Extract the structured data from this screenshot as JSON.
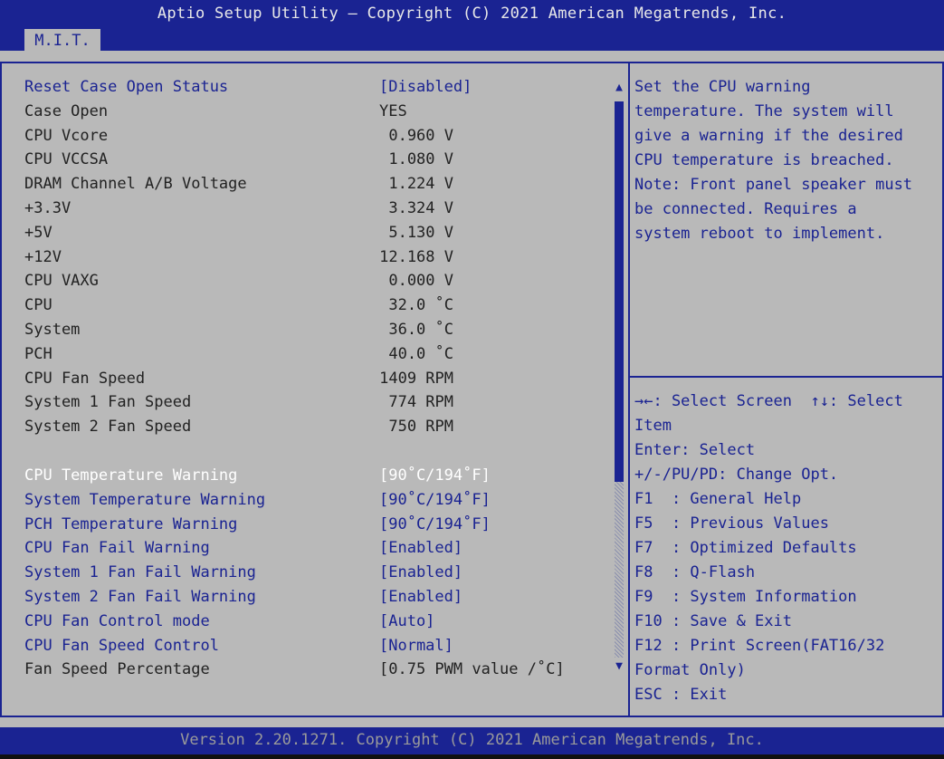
{
  "header": {
    "title": "Aptio Setup Utility – Copyright (C) 2021 American Megatrends, Inc.",
    "tab": "M.I.T."
  },
  "settings": [
    {
      "label": "Reset Case Open Status",
      "value": "[Disabled]",
      "style": "blue",
      "editable": true
    },
    {
      "label": "Case Open",
      "value": "YES",
      "style": "dark",
      "editable": false
    },
    {
      "label": "CPU Vcore",
      "value": "0.960 V",
      "style": "dark",
      "editable": false
    },
    {
      "label": "CPU VCCSA",
      "value": "1.080 V",
      "style": "dark",
      "editable": false
    },
    {
      "label": "DRAM Channel A/B Voltage",
      "value": "1.224 V",
      "style": "dark",
      "editable": false
    },
    {
      "label": "+3.3V",
      "value": "3.324 V",
      "style": "dark",
      "editable": false
    },
    {
      "label": "+5V",
      "value": "5.130 V",
      "style": "dark",
      "editable": false
    },
    {
      "label": "+12V",
      "value": "12.168 V",
      "style": "dark",
      "editable": false
    },
    {
      "label": "CPU VAXG",
      "value": "0.000 V",
      "style": "dark",
      "editable": false
    },
    {
      "label": "CPU",
      "value": "32.0 ˚C",
      "style": "dark",
      "editable": false
    },
    {
      "label": "System",
      "value": "36.0 ˚C",
      "style": "dark",
      "editable": false
    },
    {
      "label": "PCH",
      "value": "40.0 ˚C",
      "style": "dark",
      "editable": false
    },
    {
      "label": "CPU Fan Speed",
      "value": "1409 RPM",
      "style": "dark",
      "editable": false
    },
    {
      "label": "System 1 Fan Speed",
      "value": "774 RPM",
      "style": "dark",
      "editable": false
    },
    {
      "label": "System 2 Fan Speed",
      "value": "750 RPM",
      "style": "dark",
      "editable": false
    },
    {
      "label": "CPU Temperature Warning",
      "value": "[90˚C/194˚F]",
      "style": "white",
      "editable": true
    },
    {
      "label": "System Temperature Warning",
      "value": "[90˚C/194˚F]",
      "style": "blue",
      "editable": true
    },
    {
      "label": "PCH Temperature Warning",
      "value": "[90˚C/194˚F]",
      "style": "blue",
      "editable": true
    },
    {
      "label": "CPU Fan Fail Warning",
      "value": "[Enabled]",
      "style": "blue",
      "editable": true
    },
    {
      "label": "System 1 Fan Fail Warning",
      "value": "[Enabled]",
      "style": "blue",
      "editable": true
    },
    {
      "label": "System 2 Fan Fail Warning",
      "value": "[Enabled]",
      "style": "blue",
      "editable": true
    },
    {
      "label": "CPU Fan Control mode",
      "value": "[Auto]",
      "style": "blue",
      "editable": true
    },
    {
      "label": "CPU Fan Speed Control",
      "value": "[Normal]",
      "style": "blue",
      "editable": true
    },
    {
      "label": "Fan Speed Percentage",
      "value": "[0.75 PWM value /˚C]",
      "style": "dark",
      "editable": false
    }
  ],
  "help": [
    "Set the CPU warning",
    "temperature. The system will",
    "give a warning if the desired",
    "CPU temperature is breached.",
    "Note: Front panel speaker must",
    "be connected. Requires a",
    "system reboot to implement."
  ],
  "keys": [
    "→←: Select Screen  ↑↓: Select",
    "Item",
    "Enter: Select",
    "+/-/PU/PD: Change Opt.",
    "F1  : General Help",
    "F5  : Previous Values",
    "F7  : Optimized Defaults",
    "F8  : Q-Flash",
    "F9  : System Information",
    "F10 : Save & Exit",
    "F12 : Print Screen(FAT16/32",
    "Format Only)",
    "ESC : Exit"
  ],
  "scrollbar": {
    "up": "▲",
    "down": "▼"
  },
  "footer": {
    "text": "Version 2.20.1271. Copyright (C) 2021 American Megatrends, Inc."
  }
}
